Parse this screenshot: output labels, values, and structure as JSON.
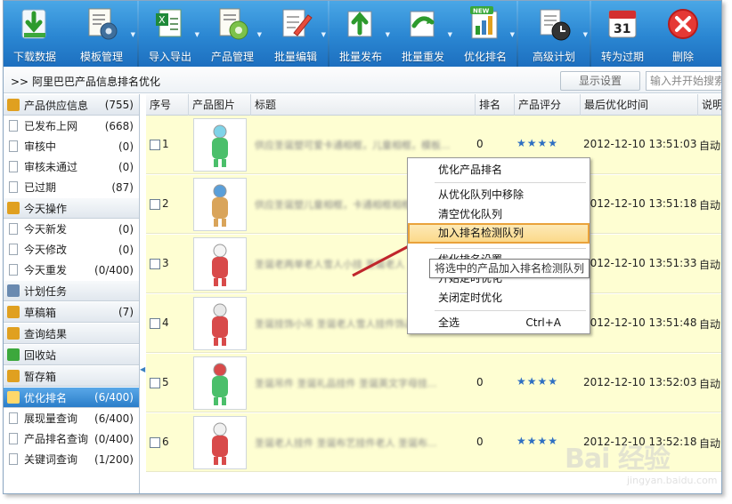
{
  "toolbar": {
    "items": [
      {
        "label": "下载数据",
        "icon": "download-icon",
        "arrow": "▼"
      },
      {
        "label": "模板管理",
        "icon": "template-gear-icon",
        "arrow": "▼"
      },
      {
        "label": "导入导出",
        "icon": "excel-icon",
        "arrow": "▼"
      },
      {
        "label": "产品管理",
        "icon": "product-gear-icon",
        "arrow": "▼"
      },
      {
        "label": "批量编辑",
        "icon": "edit-icon",
        "arrow": "▼"
      },
      {
        "label": "批量发布",
        "icon": "publish-icon",
        "arrow": "▼"
      },
      {
        "label": "批量重发",
        "icon": "republish-icon",
        "arrow": "▼"
      },
      {
        "label": "优化排名",
        "icon": "ranking-chart-icon",
        "badge": "NEW",
        "arrow": "▼"
      },
      {
        "label": "高级计划",
        "icon": "clock-plan-icon",
        "arrow": "▼"
      },
      {
        "label": "转为过期",
        "icon": "calendar-icon",
        "calendar_day": "31"
      },
      {
        "label": "删除",
        "icon": "delete-icon"
      }
    ]
  },
  "navbar": {
    "prefix": ">>",
    "title": "阿里巴巴产品信息排名优化",
    "show_settings": "显示设置",
    "search_placeholder": "输入并开始搜索"
  },
  "sidebar": {
    "collapse_glyph": "◀",
    "sections": [
      {
        "label": "产品供应信息",
        "count": "(755)",
        "icon": "folder-icon",
        "items": [
          {
            "label": "已发布上网",
            "count": "(668)"
          },
          {
            "label": "审核中",
            "count": "(0)"
          },
          {
            "label": "审核未通过",
            "count": "(0)"
          },
          {
            "label": "已过期",
            "count": "(87)"
          }
        ]
      },
      {
        "label": "今天操作",
        "count": "",
        "icon": "today-icon",
        "items": [
          {
            "label": "今天新发",
            "count": "(0)"
          },
          {
            "label": "今天修改",
            "count": "(0)"
          },
          {
            "label": "今天重发",
            "count": "(0/400)"
          }
        ]
      },
      {
        "label": "计划任务",
        "count": "",
        "icon": "task-icon",
        "items": []
      },
      {
        "label": "草稿箱",
        "count": "(7)",
        "icon": "draft-icon",
        "items": []
      },
      {
        "label": "查询结果",
        "count": "",
        "icon": "query-icon",
        "items": []
      },
      {
        "label": "回收站",
        "count": "",
        "icon": "recycle-icon",
        "items": []
      },
      {
        "label": "暂存箱",
        "count": "",
        "icon": "storage-icon",
        "items": []
      },
      {
        "label": "优化排名",
        "count": "(6/400)",
        "icon": "rank-folder-icon",
        "active": true,
        "items": [
          {
            "label": "展现量查询",
            "count": "(6/400)"
          },
          {
            "label": "产品排名查询",
            "count": "(0/400)"
          },
          {
            "label": "关键词查询",
            "count": "(1/200)"
          }
        ]
      }
    ]
  },
  "grid": {
    "columns": [
      "序号",
      "产品图片",
      "标题",
      "排名",
      "产品评分",
      "最后优化时间",
      "说明"
    ],
    "rows": [
      {
        "id": "1",
        "title": "供应圣诞塑可爱卡通相框，儿童相框，模板...",
        "rank": "0",
        "stars": "★★★★",
        "date": "2012-12-10  13:51:03",
        "note": "自动"
      },
      {
        "id": "2",
        "title": "供应圣诞塑儿童相框，卡通相框相框相框",
        "rank": "",
        "stars": "",
        "date": "2012-12-10  13:51:18",
        "note": "自动"
      },
      {
        "id": "3",
        "title": "圣诞老两单老人雪人小挂 圣诞老人",
        "rank": "",
        "stars": "",
        "date": "2012-12-10  13:51:33",
        "note": "自动"
      },
      {
        "id": "4",
        "title": "圣诞挂饰小吊 圣诞老人雪人挂件饰品",
        "rank": "",
        "stars": "",
        "date": "2012-12-10  13:51:48",
        "note": "自动"
      },
      {
        "id": "5",
        "title": "圣诞吊件 圣诞礼品挂件 圣诞英文字母挂...",
        "rank": "0",
        "stars": "★★★★",
        "date": "2012-12-10  13:52:03",
        "note": "自动"
      },
      {
        "id": "6",
        "title": "圣诞老人挂件 圣诞布艺挂件老人 圣诞布...",
        "rank": "0",
        "stars": "★★★★",
        "date": "2012-12-10  13:52:18",
        "note": "自动"
      }
    ]
  },
  "context_menu": {
    "items": [
      {
        "label": "优化产品排名",
        "shortcut": ""
      },
      {
        "label": "从优化队列中移除",
        "shortcut": ""
      },
      {
        "label": "清空优化队列",
        "shortcut": ""
      },
      {
        "label": "加入排名检测队列",
        "shortcut": "",
        "highlighted": true
      },
      {
        "label": "优化排名设置",
        "shortcut": ""
      },
      {
        "label": "开始定时优化",
        "shortcut": ""
      },
      {
        "label": "关闭定时优化",
        "shortcut": ""
      },
      {
        "label": "全选",
        "shortcut": "Ctrl+A"
      }
    ],
    "tooltip": "将选中的产品加入排名检测队列"
  },
  "watermark": {
    "main": "Bai 经验",
    "sub": "jingyan.baidu.com"
  },
  "colors": {
    "toolbar": "#2a86d2",
    "row_bg": "#fefed2",
    "highlight_border": "#e9a23b",
    "arrow": "#c0262c",
    "stars": "#2e6fc2"
  }
}
